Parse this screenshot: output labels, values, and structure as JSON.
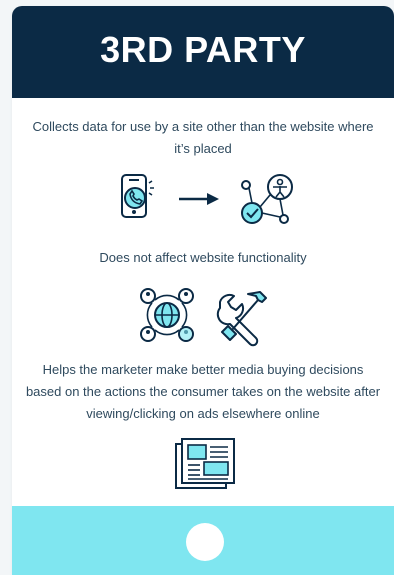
{
  "header": {
    "title": "3RD PARTY"
  },
  "sections": [
    {
      "text": "Collects data for use by a site other than the website where it’s placed"
    },
    {
      "text": "Does not affect website functionality"
    },
    {
      "text": "Helps the marketer make better media buying decisions based on the actions the consumer takes on the website after viewing/clicking on ads elsewhere online"
    }
  ],
  "colors": {
    "navy": "#0b2a45",
    "accent": "#7fe6f0",
    "text": "#2f4a5e"
  },
  "icons": [
    "phone-call-icon",
    "arrow-right-icon",
    "user-network-icon",
    "global-people-icon",
    "tools-icon",
    "newspaper-icon"
  ]
}
